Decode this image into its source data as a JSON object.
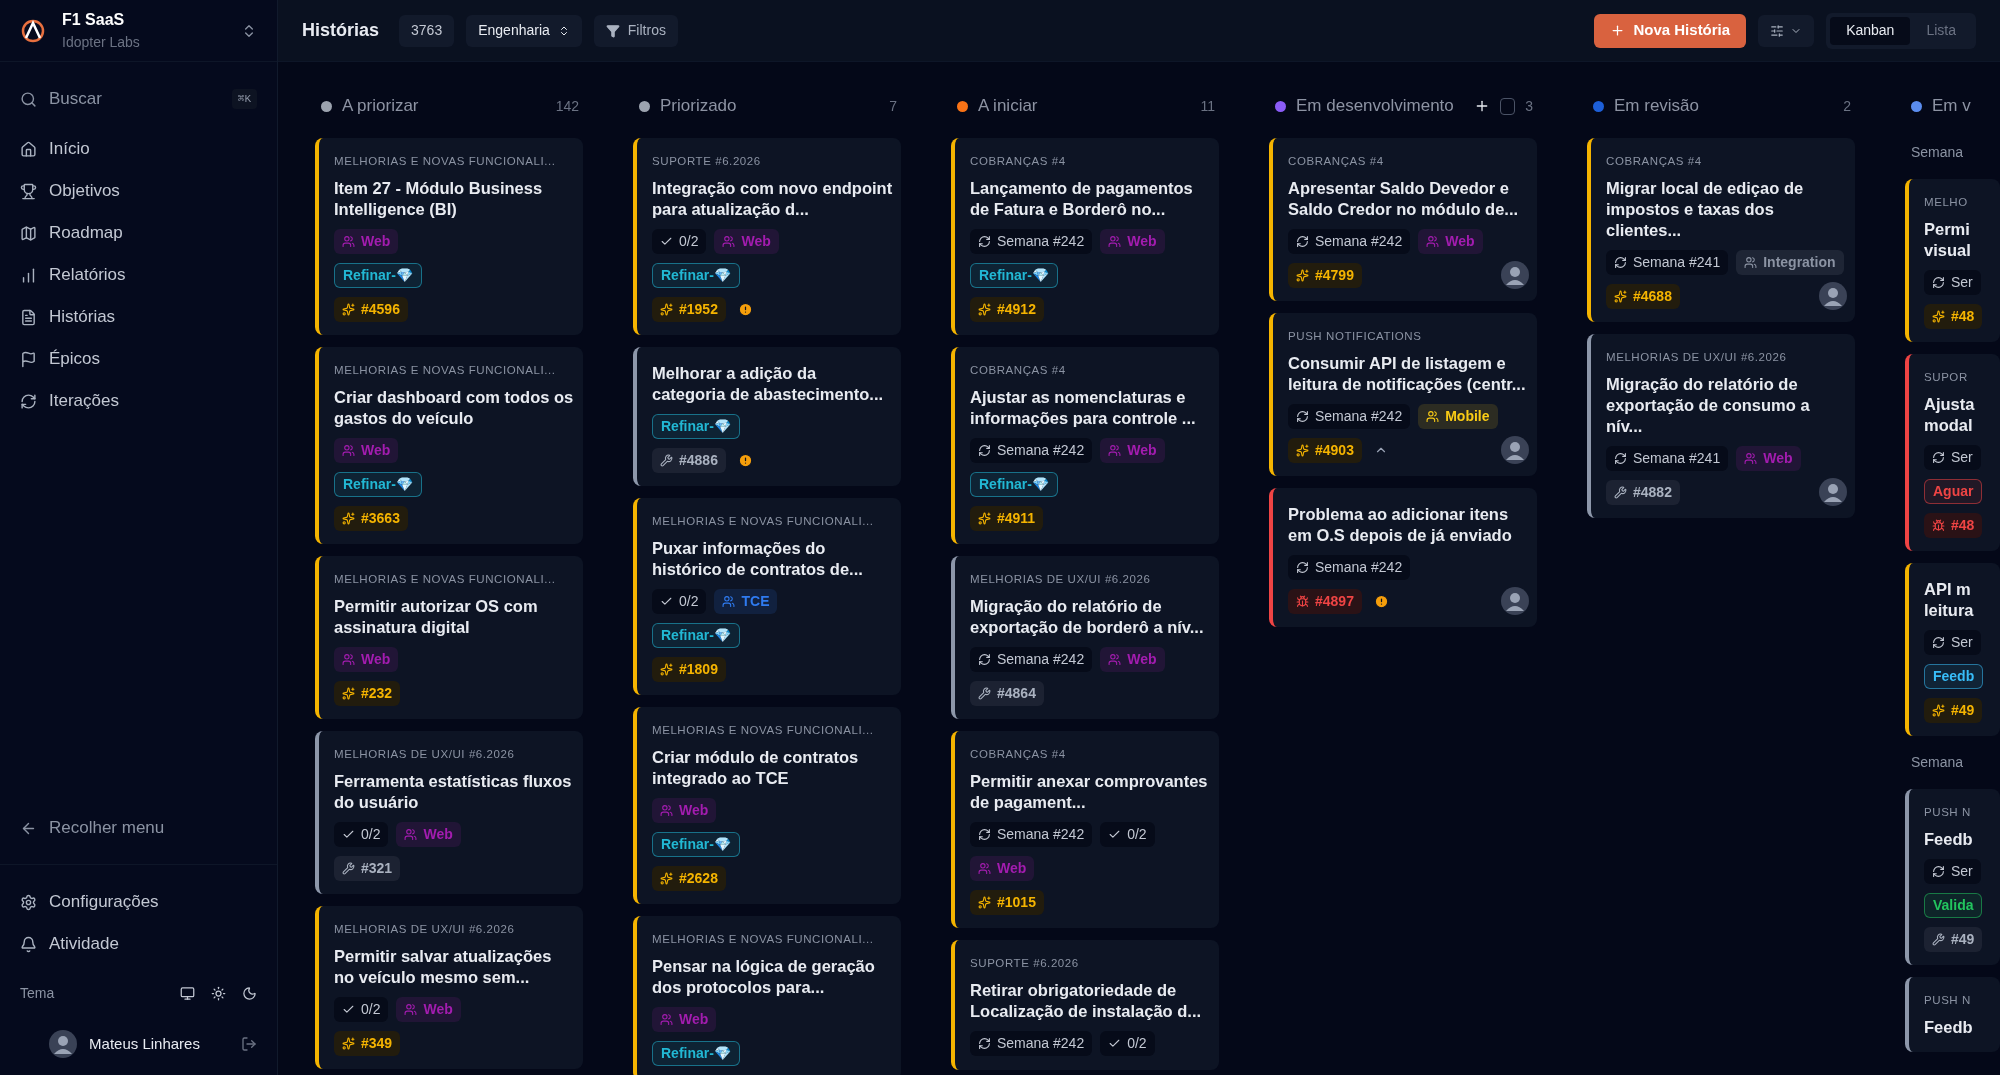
{
  "sidebar": {
    "workspace": {
      "name": "F1 SaaS",
      "org": "Idopter Labs"
    },
    "search": {
      "placeholder": "Buscar",
      "shortcut": "⌘K"
    },
    "items": [
      {
        "label": "Início"
      },
      {
        "label": "Objetivos"
      },
      {
        "label": "Roadmap"
      },
      {
        "label": "Relatórios"
      },
      {
        "label": "Histórias"
      },
      {
        "label": "Épicos"
      },
      {
        "label": "Iterações"
      }
    ],
    "collapse": "Recolher menu",
    "bottom_items": [
      {
        "label": "Configurações"
      },
      {
        "label": "Atividade"
      }
    ],
    "theme": {
      "label": "Tema"
    },
    "user": {
      "name": "Mateus Linhares"
    }
  },
  "header": {
    "title": "Histórias",
    "count": "3763",
    "team": "Engenharia",
    "filters": "Filtros",
    "new_button": "Nova História",
    "views": [
      {
        "label": "Kanban",
        "selected": true
      },
      {
        "label": "Lista",
        "selected": false
      }
    ]
  },
  "columns": [
    {
      "name": "A priorizar",
      "count": "142",
      "color": "#9ca3af",
      "groups": [
        {
          "cards": [
            {
              "kind": "feature",
              "epic": "MELHORIAS E NOVAS FUNCIONALI...",
              "title": "Item 27 - Módulo Business Intelligence (BI)",
              "rows": [
                [
                  {
                    "kind": "team",
                    "text": "Web",
                    "color": "#a31caf"
                  }
                ],
                [
                  {
                    "kind": "label",
                    "text": "Refinar-💎",
                    "color": "#22b8d4"
                  }
                ]
              ],
              "id": "#4596"
            },
            {
              "kind": "feature",
              "epic": "MELHORIAS E NOVAS FUNCIONALI...",
              "title": "Criar dashboard com todos os gastos do veículo",
              "rows": [
                [
                  {
                    "kind": "team",
                    "text": "Web",
                    "color": "#a31caf"
                  }
                ],
                [
                  {
                    "kind": "label",
                    "text": "Refinar-💎",
                    "color": "#22b8d4"
                  }
                ]
              ],
              "id": "#3663"
            },
            {
              "kind": "feature",
              "epic": "MELHORIAS E NOVAS FUNCIONALI...",
              "title": "Permitir autorizar OS com assinatura digital",
              "rows": [
                [
                  {
                    "kind": "team",
                    "text": "Web",
                    "color": "#a31caf"
                  }
                ]
              ],
              "id": "#232"
            },
            {
              "kind": "chore",
              "epic": "MELHORIAS DE UX/UI #6.2026",
              "title": "Ferramenta estatísticas fluxos do usuário",
              "rows": [
                [
                  {
                    "kind": "checklist",
                    "text": "0/2"
                  },
                  {
                    "kind": "team",
                    "text": "Web",
                    "color": "#a31caf"
                  }
                ]
              ],
              "id": "#321"
            },
            {
              "kind": "feature",
              "epic": "MELHORIAS DE UX/UI #6.2026",
              "title": "Permitir salvar atualizações no veículo mesmo sem...",
              "rows": [
                [
                  {
                    "kind": "checklist",
                    "text": "0/2"
                  },
                  {
                    "kind": "team",
                    "text": "Web",
                    "color": "#a31caf"
                  }
                ]
              ],
              "id": "#349"
            }
          ]
        }
      ]
    },
    {
      "name": "Priorizado",
      "count": "7",
      "color": "#9ca3af",
      "groups": [
        {
          "cards": [
            {
              "kind": "feature",
              "epic": "SUPORTE #6.2026",
              "title": "Integração com novo endpoint para atualização d...",
              "rows": [
                [
                  {
                    "kind": "checklist",
                    "text": "0/2"
                  },
                  {
                    "kind": "team",
                    "text": "Web",
                    "color": "#a31caf"
                  }
                ],
                [
                  {
                    "kind": "label",
                    "text": "Refinar-💎",
                    "color": "#22b8d4"
                  }
                ]
              ],
              "id": "#1952",
              "warning": true
            },
            {
              "kind": "chore",
              "title": "Melhorar a adição da categoria de abastecimento...",
              "rows": [
                [
                  {
                    "kind": "label",
                    "text": "Refinar-💎",
                    "color": "#22b8d4"
                  }
                ]
              ],
              "id": "#4886",
              "warning": true
            },
            {
              "kind": "feature",
              "epic": "MELHORIAS E NOVAS FUNCIONALI...",
              "title": "Puxar informações do histórico de contratos de...",
              "rows": [
                [
                  {
                    "kind": "checklist",
                    "text": "0/2"
                  },
                  {
                    "kind": "team",
                    "text": "TCE",
                    "color": "#2f7bf0"
                  }
                ],
                [
                  {
                    "kind": "label",
                    "text": "Refinar-💎",
                    "color": "#22b8d4"
                  }
                ]
              ],
              "id": "#1809"
            },
            {
              "kind": "feature",
              "epic": "MELHORIAS E NOVAS FUNCIONALI...",
              "title": "Criar módulo de contratos integrado ao TCE",
              "rows": [
                [
                  {
                    "kind": "team",
                    "text": "Web",
                    "color": "#a31caf"
                  }
                ],
                [
                  {
                    "kind": "label",
                    "text": "Refinar-💎",
                    "color": "#22b8d4"
                  }
                ]
              ],
              "id": "#2628"
            },
            {
              "kind": "feature",
              "epic": "MELHORIAS E NOVAS FUNCIONALI...",
              "title": "Pensar na lógica de geração dos protocolos para...",
              "rows": [
                [
                  {
                    "kind": "team",
                    "text": "Web",
                    "color": "#a31caf"
                  }
                ],
                [
                  {
                    "kind": "label",
                    "text": "Refinar-💎",
                    "color": "#22b8d4"
                  }
                ]
              ]
            }
          ]
        }
      ]
    },
    {
      "name": "A iniciar",
      "count": "11",
      "color": "#f97316",
      "groups": [
        {
          "cards": [
            {
              "kind": "feature",
              "epic": "COBRANÇAS #4",
              "title": "Lançamento de pagamentos de Fatura e Borderô no...",
              "rows": [
                [
                  {
                    "kind": "iteration",
                    "text": "Semana #242"
                  },
                  {
                    "kind": "team",
                    "text": "Web",
                    "color": "#a31caf"
                  }
                ],
                [
                  {
                    "kind": "label",
                    "text": "Refinar-💎",
                    "color": "#22b8d4"
                  }
                ]
              ],
              "id": "#4912"
            },
            {
              "kind": "feature",
              "epic": "COBRANÇAS #4",
              "title": "Ajustar as nomenclaturas e informações para controle ...",
              "rows": [
                [
                  {
                    "kind": "iteration",
                    "text": "Semana #242"
                  },
                  {
                    "kind": "team",
                    "text": "Web",
                    "color": "#a31caf"
                  }
                ],
                [
                  {
                    "kind": "label",
                    "text": "Refinar-💎",
                    "color": "#22b8d4"
                  }
                ]
              ],
              "id": "#4911"
            },
            {
              "kind": "chore",
              "epic": "MELHORIAS DE UX/UI #6.2026",
              "title": "Migração do relatório de exportação de borderô a nív...",
              "rows": [
                [
                  {
                    "kind": "iteration",
                    "text": "Semana #242"
                  },
                  {
                    "kind": "team",
                    "text": "Web",
                    "color": "#a31caf"
                  }
                ]
              ],
              "id": "#4864"
            },
            {
              "kind": "feature",
              "epic": "COBRANÇAS #4",
              "title": "Permitir anexar comprovantes de pagament...",
              "rows": [
                [
                  {
                    "kind": "iteration",
                    "text": "Semana #242"
                  },
                  {
                    "kind": "checklist",
                    "text": "0/2"
                  }
                ],
                [
                  {
                    "kind": "team",
                    "text": "Web",
                    "color": "#a31caf"
                  }
                ]
              ],
              "id": "#1015"
            },
            {
              "kind": "feature",
              "epic": "SUPORTE #6.2026",
              "title": "Retirar obrigatoriedade de Localização de instalação d...",
              "rows": [
                [
                  {
                    "kind": "iteration",
                    "text": "Semana #242"
                  },
                  {
                    "kind": "checklist",
                    "text": "0/2"
                  }
                ]
              ]
            }
          ]
        }
      ]
    },
    {
      "name": "Em desenvolvimento",
      "count": "3",
      "color": "#8b5cf6",
      "add": true,
      "checkbox": {
        "checked": false
      },
      "groups": [
        {
          "cards": [
            {
              "kind": "feature",
              "epic": "COBRANÇAS #4",
              "title": "Apresentar Saldo Devedor e Saldo Credor no módulo de...",
              "rows": [
                [
                  {
                    "kind": "iteration",
                    "text": "Semana #242"
                  },
                  {
                    "kind": "team",
                    "text": "Web",
                    "color": "#a31caf"
                  }
                ]
              ],
              "id": "#4799",
              "avatar": true
            },
            {
              "kind": "feature",
              "epic": "PUSH NOTIFICATIONS",
              "title": "Consumir API de listagem e leitura de notificações (centr...",
              "rows": [
                [
                  {
                    "kind": "iteration",
                    "text": "Semana #242"
                  },
                  {
                    "kind": "team",
                    "text": "Mobile",
                    "color": "#facc15"
                  }
                ]
              ],
              "id": "#4903",
              "expand": true,
              "avatar": true
            },
            {
              "kind": "bug",
              "title": "Problema ao adicionar itens em O.S depois de já enviado",
              "rows": [
                [
                  {
                    "kind": "iteration",
                    "text": "Semana #242"
                  }
                ]
              ],
              "id": "#4897",
              "warning": true,
              "avatar": true
            }
          ]
        }
      ]
    },
    {
      "name": "Em revisão",
      "count": "2",
      "color": "#1d5fd8",
      "groups": [
        {
          "cards": [
            {
              "kind": "feature",
              "epic": "COBRANÇAS #4",
              "title": "Migrar local de ediçao de impostos e taxas dos clientes...",
              "rows": [
                [
                  {
                    "kind": "iteration",
                    "text": "Semana #241"
                  },
                  {
                    "kind": "team",
                    "text": "Integration",
                    "color": "#8b93a3"
                  }
                ]
              ],
              "id": "#4688",
              "avatar": true
            },
            {
              "kind": "chore",
              "epic": "MELHORIAS DE UX/UI #6.2026",
              "title": "Migração do relatório de exportação de consumo a nív...",
              "rows": [
                [
                  {
                    "kind": "iteration",
                    "text": "Semana #241"
                  },
                  {
                    "kind": "team",
                    "text": "Web",
                    "color": "#a31caf"
                  }
                ]
              ],
              "id": "#4882",
              "avatar": true
            }
          ]
        }
      ]
    },
    {
      "name": "Em v",
      "color": "#5b8def",
      "groups": [
        {
          "label": "Semana",
          "cards": [
            {
              "kind": "feature",
              "epic": "MELHO",
              "title": "Permi visual",
              "rows": [
                [
                  {
                    "kind": "iteration",
                    "text": "Ser"
                  }
                ]
              ],
              "id": "#48"
            },
            {
              "kind": "bug",
              "epic": "SUPOR",
              "title": "Ajusta modal",
              "rows": [
                [
                  {
                    "kind": "iteration",
                    "text": "Ser"
                  }
                ],
                [
                  {
                    "kind": "label",
                    "text": "Aguar",
                    "color": "#ef4444"
                  }
                ]
              ],
              "id": "#48"
            },
            {
              "kind": "feature",
              "title": "API m leitura",
              "rows": [
                [
                  {
                    "kind": "iteration",
                    "text": "Ser"
                  }
                ],
                [
                  {
                    "kind": "label",
                    "text": "Feedb",
                    "color": "#38bdf8"
                  }
                ]
              ],
              "id": "#49"
            }
          ]
        },
        {
          "label": "Semana",
          "cards": [
            {
              "kind": "chore",
              "epic": "PUSH N",
              "title": "Feedb",
              "rows": [
                [
                  {
                    "kind": "iteration",
                    "text": "Ser"
                  }
                ],
                [
                  {
                    "kind": "label",
                    "text": "Valida",
                    "color": "#22c55e"
                  }
                ]
              ],
              "id": "#49"
            },
            {
              "kind": "chore",
              "epic": "PUSH N",
              "title": "Feedb"
            }
          ]
        }
      ]
    }
  ]
}
